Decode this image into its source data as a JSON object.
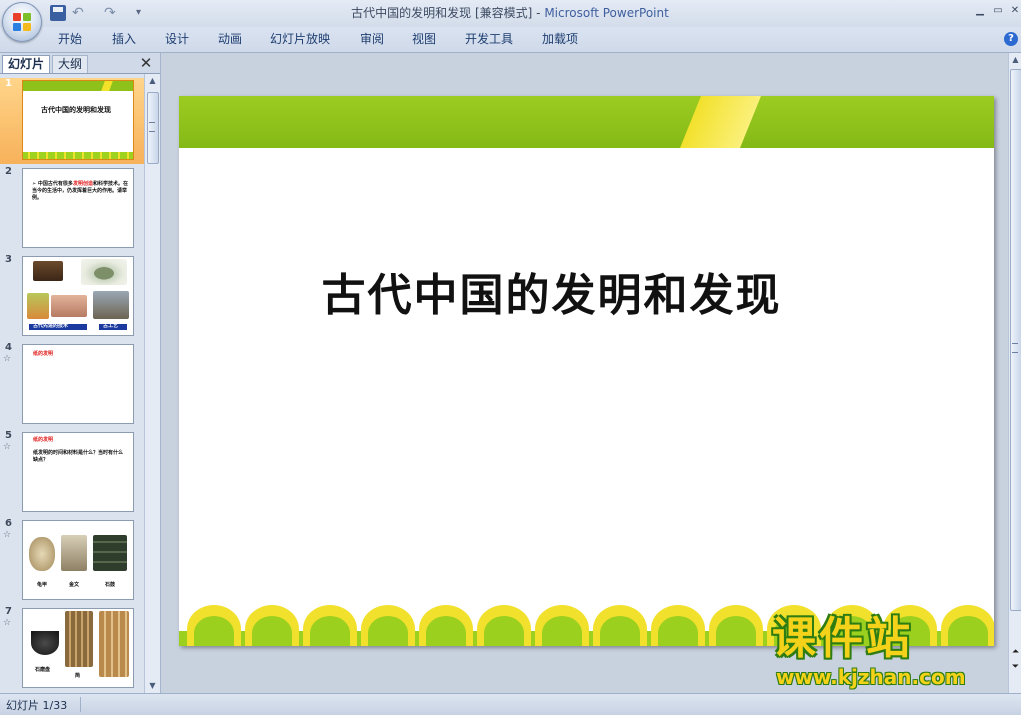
{
  "window": {
    "title": "古代中国的发明和发现 [兼容模式] - ",
    "app_name": "Microsoft PowerPoint",
    "min_icon": "minimize-icon",
    "max_icon": "maximize-icon",
    "close_icon": "close-icon"
  },
  "quick_access": {
    "undo": "↶",
    "redo": "↷",
    "more": "▾"
  },
  "ribbon": {
    "tabs": [
      "开始",
      "插入",
      "设计",
      "动画",
      "幻灯片放映",
      "审阅",
      "视图",
      "开发工具",
      "加载项"
    ],
    "help": "?"
  },
  "left_pane": {
    "tabs": [
      "幻灯片",
      "大纲"
    ],
    "close": "✕",
    "slides": [
      {
        "number": "1",
        "text": "古代中国的发明和发现",
        "has_animation": false,
        "selected": true
      },
      {
        "number": "2",
        "text_prefix": "➢ 中国古代有很多",
        "text_highlight": "发明创造",
        "text_suffix": "和科学技术。在当今的生活中，仍发挥着巨大的作用。请举例。",
        "has_animation": false,
        "selected": false
      },
      {
        "number": "3",
        "captions": [
          "古代先进的技术",
          "古工艺"
        ],
        "has_animation": false,
        "selected": false
      },
      {
        "number": "4",
        "heading": "纸的发明",
        "has_animation": true,
        "selected": false
      },
      {
        "number": "5",
        "heading": "纸的发明",
        "body": "纸发明的时间和材料是什么？当时有什么缺点？",
        "has_animation": true,
        "selected": false
      },
      {
        "number": "6",
        "captions": [
          "龟甲",
          "金文",
          "石鼓"
        ],
        "has_animation": true,
        "selected": false
      },
      {
        "number": "7",
        "captions": [
          "石磨盘",
          "简"
        ],
        "has_animation": true,
        "selected": false
      }
    ],
    "animation_icon": "☆"
  },
  "slide": {
    "title": "古代中国的发明和发现"
  },
  "watermark": {
    "text": "课件站",
    "url": "www.kjzhan.com"
  },
  "status_bar": {
    "slide_indicator": "幻灯片 1/33"
  },
  "colors": {
    "band_green": "#8fc11b",
    "stripe_yellow": "#f2e12c",
    "selection": "#f7b15a"
  }
}
